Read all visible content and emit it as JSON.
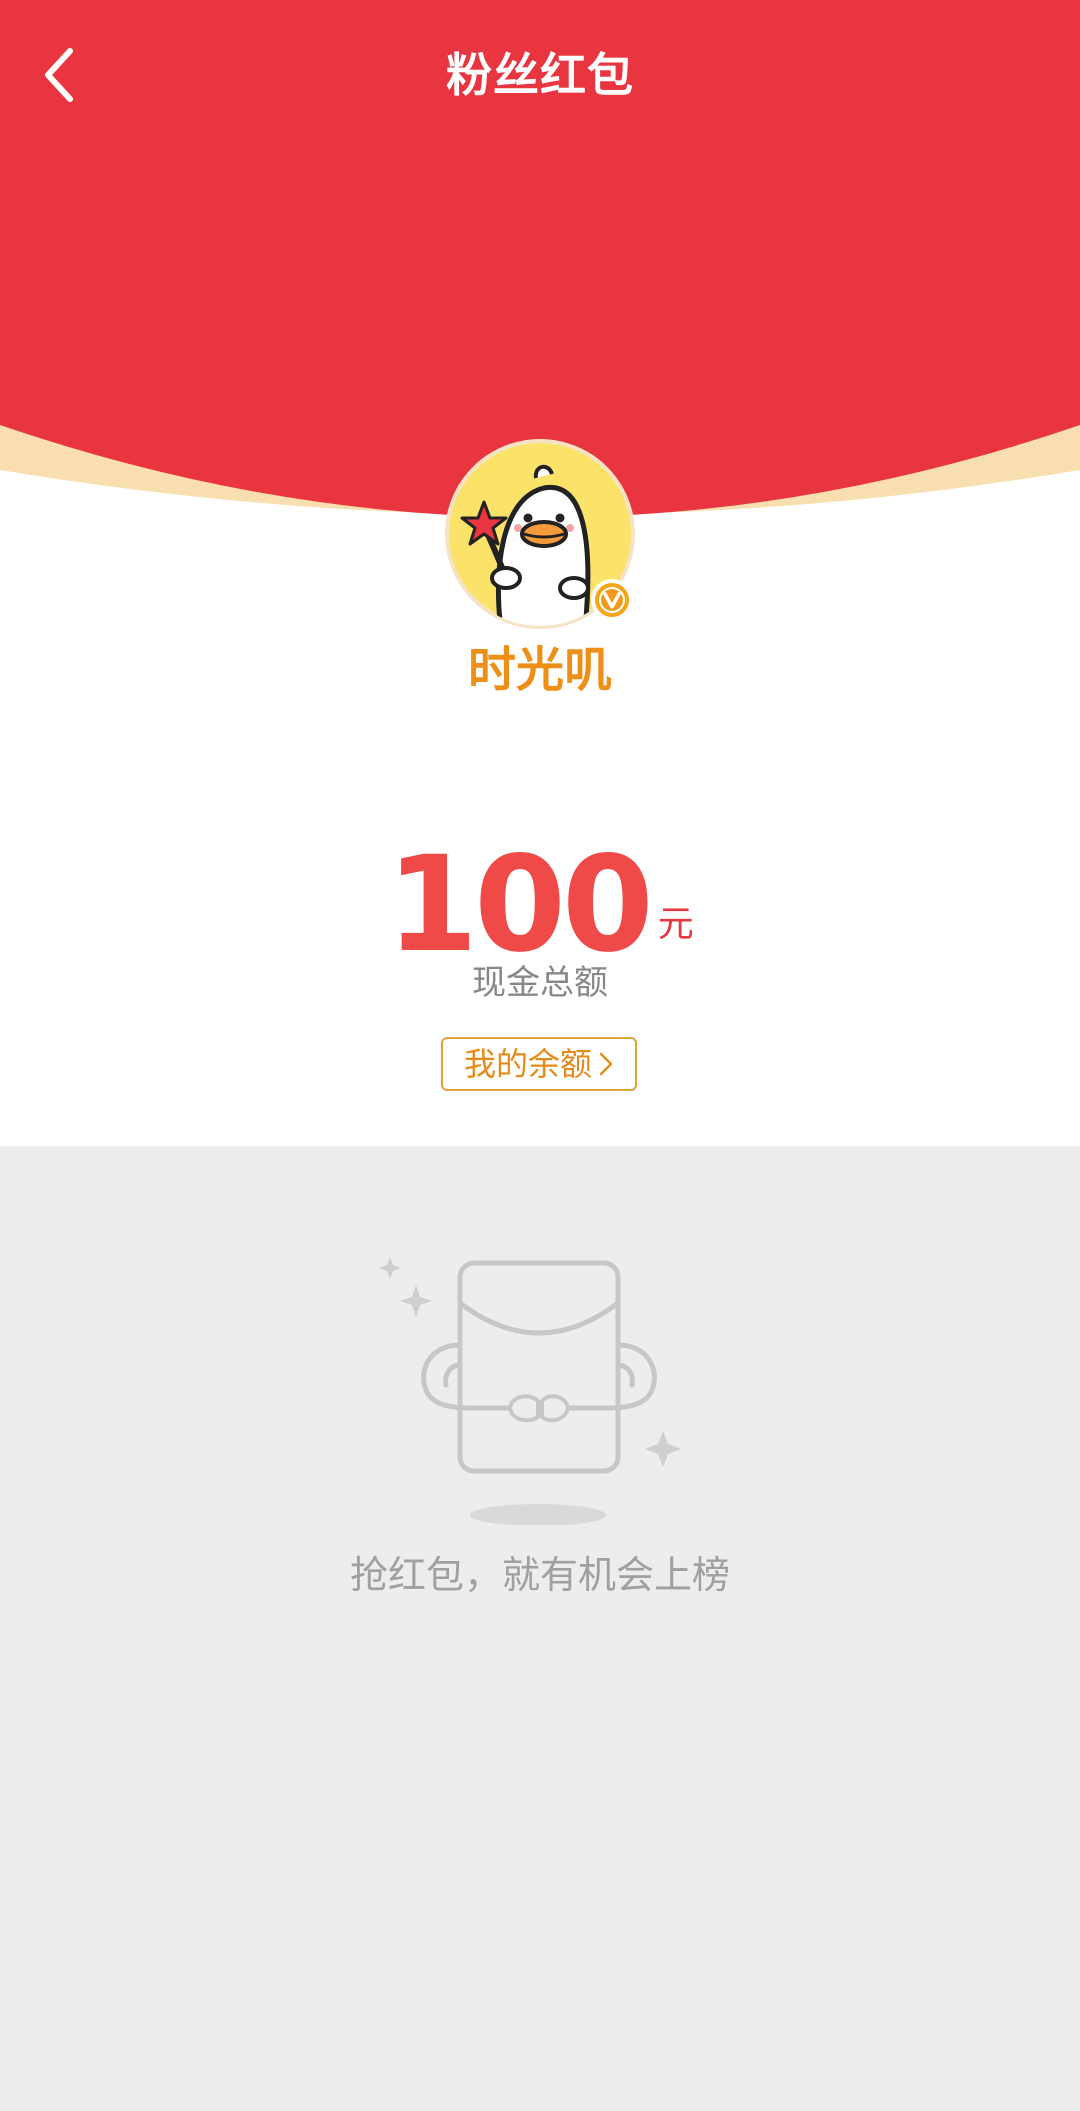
{
  "header": {
    "title": "粉丝红包",
    "back_icon": "chevron-left-icon"
  },
  "sender": {
    "name": "时光叽",
    "avatar": "duck-avatar",
    "badge_icon": "verified-v-icon"
  },
  "amount": {
    "value": "100",
    "unit": "元",
    "label": "现金总额"
  },
  "balance_button": {
    "label": "我的余额",
    "icon": "chevron-right-icon"
  },
  "empty_state": {
    "icon": "red-envelope-empty-icon",
    "message": "抢红包，就有机会上榜"
  },
  "colors": {
    "header_red": "#e8353f",
    "header_rim": "#f9dfb0",
    "name_orange": "#ee8f17",
    "amount_red": "#f04a48",
    "empty_bg": "#ededed"
  }
}
